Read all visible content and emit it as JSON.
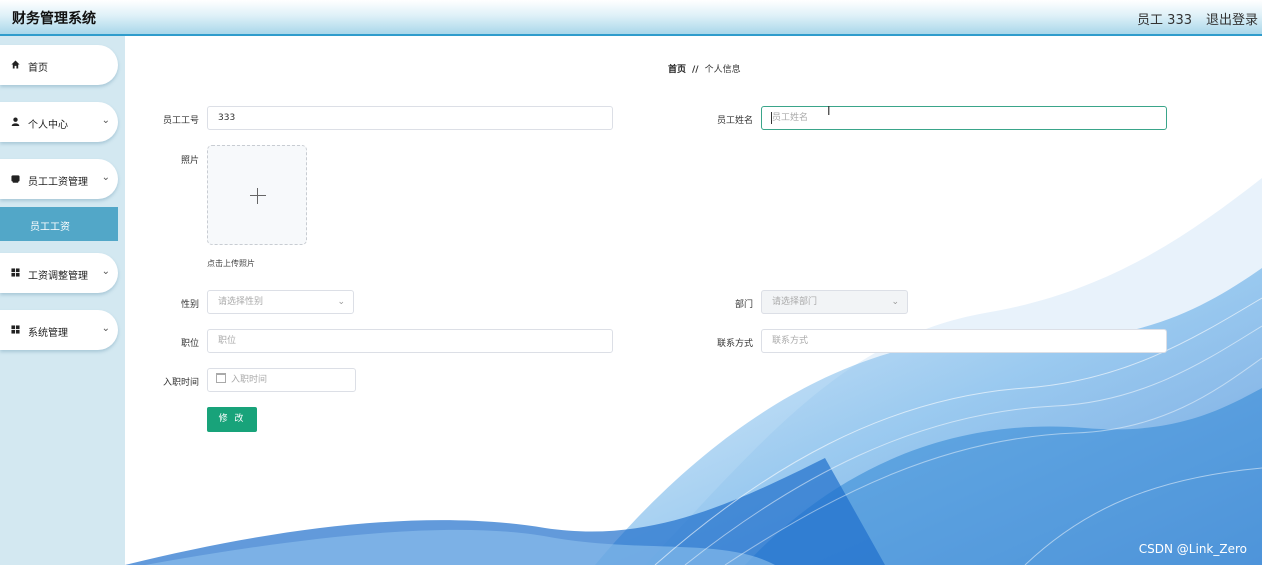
{
  "header": {
    "title": "财务管理系统",
    "user": "员工 333",
    "logout": "退出登录"
  },
  "sidebar": {
    "items": [
      {
        "label": "首页",
        "icon": "home-icon"
      },
      {
        "label": "个人中心",
        "icon": "user-icon",
        "chevron": "⌄"
      },
      {
        "label": "员工工资管理",
        "icon": "wallet-icon",
        "chevron": "⌄"
      },
      {
        "label": "工资调整管理",
        "icon": "grid-icon",
        "chevron": "⌄"
      },
      {
        "label": "系统管理",
        "icon": "grid-icon",
        "chevron": "⌄"
      }
    ],
    "sub_item": "员工工资"
  },
  "breadcrumb": {
    "home": "首页",
    "separator": "//",
    "current": "个人信息"
  },
  "form": {
    "employee_no": {
      "label": "员工工号",
      "value": "333"
    },
    "employee_name": {
      "label": "员工姓名",
      "placeholder": "员工姓名"
    },
    "photo": {
      "label": "照片",
      "hint": "点击上传照片"
    },
    "gender": {
      "label": "性别",
      "placeholder": "请选择性别"
    },
    "department": {
      "label": "部门",
      "placeholder": "请选择部门"
    },
    "position": {
      "label": "职位",
      "placeholder": "职位"
    },
    "contact": {
      "label": "联系方式",
      "placeholder": "联系方式"
    },
    "hire_date": {
      "label": "入职时间",
      "placeholder": "入职时间"
    },
    "submit": "修 改"
  },
  "watermark": "CSDN @Link_Zero",
  "colors": {
    "accent": "#52a7c8",
    "button": "#18a37a",
    "header_border": "#2f9ccc",
    "wave": "#1f7fd0"
  }
}
